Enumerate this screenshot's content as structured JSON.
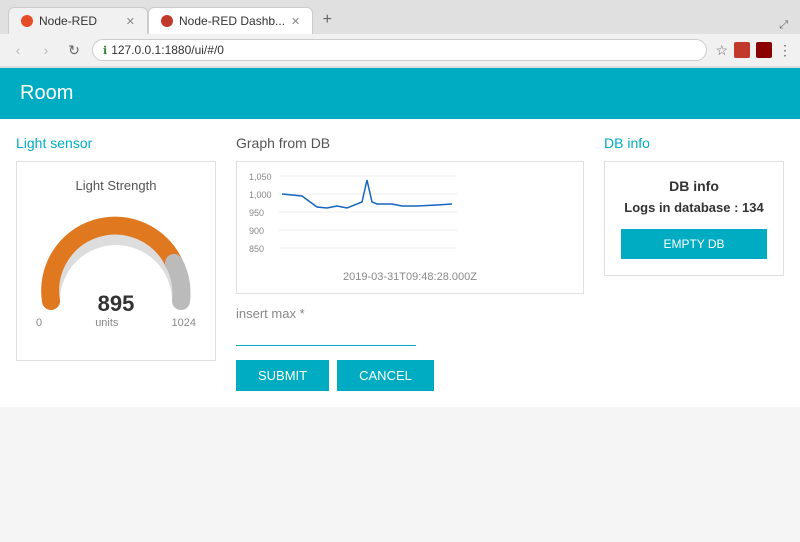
{
  "browser": {
    "tabs": [
      {
        "id": "tab1",
        "label": "Node-RED",
        "active": false,
        "icon_color": "#e44d26"
      },
      {
        "id": "tab2",
        "label": "Node-RED Dashb...",
        "active": true,
        "icon_color": "#c0392b"
      }
    ],
    "url": "127.0.0.1:1880/ui/#/0",
    "back_btn": "‹",
    "forward_btn": "›",
    "reload_btn": "↻",
    "star_icon": "☆",
    "menu_icon": "⋮"
  },
  "app": {
    "header_title": "Room"
  },
  "light_sensor": {
    "section_title": "Light sensor",
    "box_title": "Light Strength",
    "value": "895",
    "min_label": "0",
    "max_label": "1024",
    "unit_label": "units",
    "gauge_color_active": "#e07820",
    "gauge_color_inactive": "#bbb"
  },
  "graph": {
    "title": "Graph from DB",
    "timestamp": "2019-03-31T09:48:28.000Z",
    "y_labels": [
      "1,050",
      "1,000",
      "950",
      "900",
      "850"
    ],
    "insert_max_label": "insert max *",
    "submit_label": "SUBMIT",
    "cancel_label": "CANCEL"
  },
  "db_info": {
    "section_title": "DB info",
    "box_title": "DB info",
    "logs_label": "Logs in database : 134",
    "empty_db_label": "EMPTY DB"
  }
}
